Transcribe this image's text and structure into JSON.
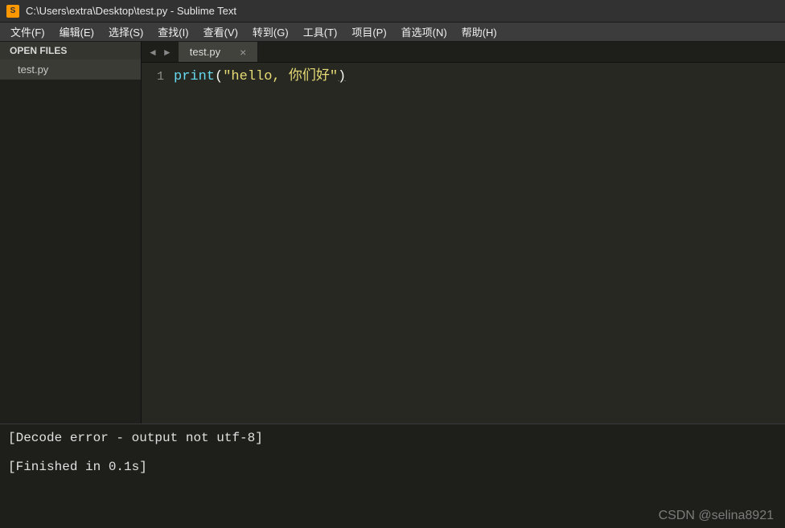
{
  "titlebar": {
    "icon_letter": "S",
    "title": "C:\\Users\\extra\\Desktop\\test.py - Sublime Text"
  },
  "menu": {
    "file": "文件(F)",
    "edit": "编辑(E)",
    "select": "选择(S)",
    "find": "查找(I)",
    "view": "查看(V)",
    "goto": "转到(G)",
    "tools": "工具(T)",
    "project": "项目(P)",
    "preferences": "首选项(N)",
    "help": "帮助(H)"
  },
  "sidebar": {
    "header": "OPEN FILES",
    "items": [
      {
        "label": "test.py"
      }
    ]
  },
  "tabs": {
    "nav_prev": "◄",
    "nav_next": "►",
    "items": [
      {
        "label": "test.py",
        "close": "×"
      }
    ]
  },
  "editor": {
    "line_number": "1",
    "tokens": {
      "func": "print",
      "open": "(",
      "str": "\"hello, 你们好\"",
      "close": ")"
    }
  },
  "output": {
    "line1": "[Decode error - output not utf-8]",
    "line2": "[Finished in 0.1s]"
  },
  "watermark": "CSDN @selina8921"
}
